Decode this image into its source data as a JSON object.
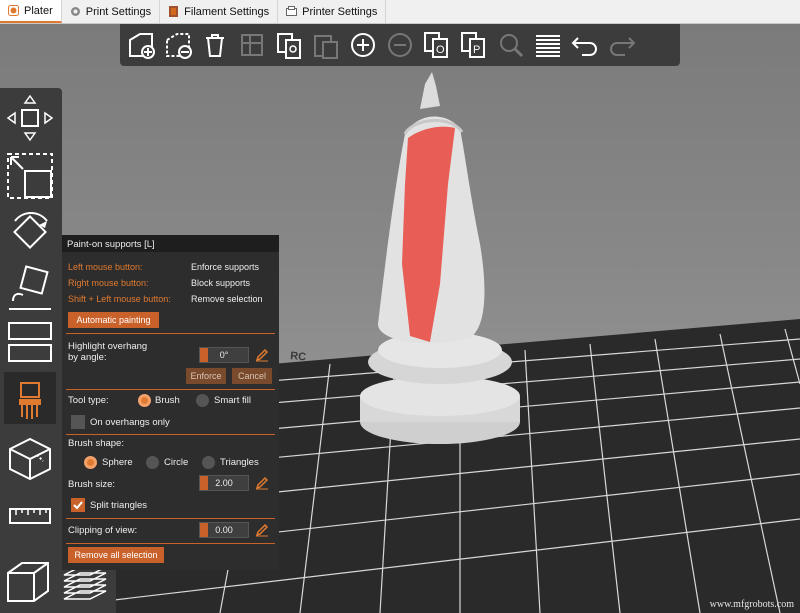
{
  "tabs": [
    {
      "label": "Plater",
      "icon": "plater-icon"
    },
    {
      "label": "Print Settings",
      "icon": "gear-icon"
    },
    {
      "label": "Filament Settings",
      "icon": "filament-icon"
    },
    {
      "label": "Printer Settings",
      "icon": "printer-icon"
    }
  ],
  "toolbar": [
    "add-object-icon",
    "delete-object-icon",
    "delete-all-icon",
    "arrange-icon",
    "copy-icon",
    "paste-icon",
    "add-instance-icon",
    "remove-instance-icon",
    "split-objects-icon",
    "split-parts-icon",
    "search-icon",
    "layers-editing-icon",
    "undo-icon",
    "redo-icon"
  ],
  "left_tools": [
    "move-icon",
    "scale-icon",
    "rotate-icon",
    "place-on-face-icon",
    "cut-icon",
    "paint-supports-icon",
    "seam-painting-icon",
    "measure-icon"
  ],
  "panel": {
    "title": "Paint-on supports [L]",
    "mouse": [
      {
        "key": "Left mouse button:",
        "value": "Enforce supports"
      },
      {
        "key": "Right mouse button:",
        "value": "Block supports"
      },
      {
        "key": "Shift + Left mouse button:",
        "value": "Remove selection"
      }
    ],
    "auto_painting": "Automatic painting",
    "highlight_label_1": "Highlight overhang",
    "highlight_label_2": "by angle:",
    "angle_value": "0°",
    "enforce": "Enforce",
    "cancel": "Cancel",
    "tool_type": "Tool type:",
    "tool_brush": "Brush",
    "tool_smart": "Smart fill",
    "overhangs_only": "On overhangs only",
    "brush_shape": "Brush shape:",
    "shape_sphere": "Sphere",
    "shape_circle": "Circle",
    "shape_triangles": "Triangles",
    "brush_size_label": "Brush size:",
    "brush_size": "2.00",
    "split_triangles": "Split triangles",
    "clipping_label": "Clipping of view:",
    "clipping_value": "0.00",
    "remove_all": "Remove all selection"
  },
  "watermark": "www.mfgrobots.com",
  "colors": {
    "accent": "#e07a30",
    "paint": "#e8524a",
    "panel": "#2d2d2d"
  }
}
